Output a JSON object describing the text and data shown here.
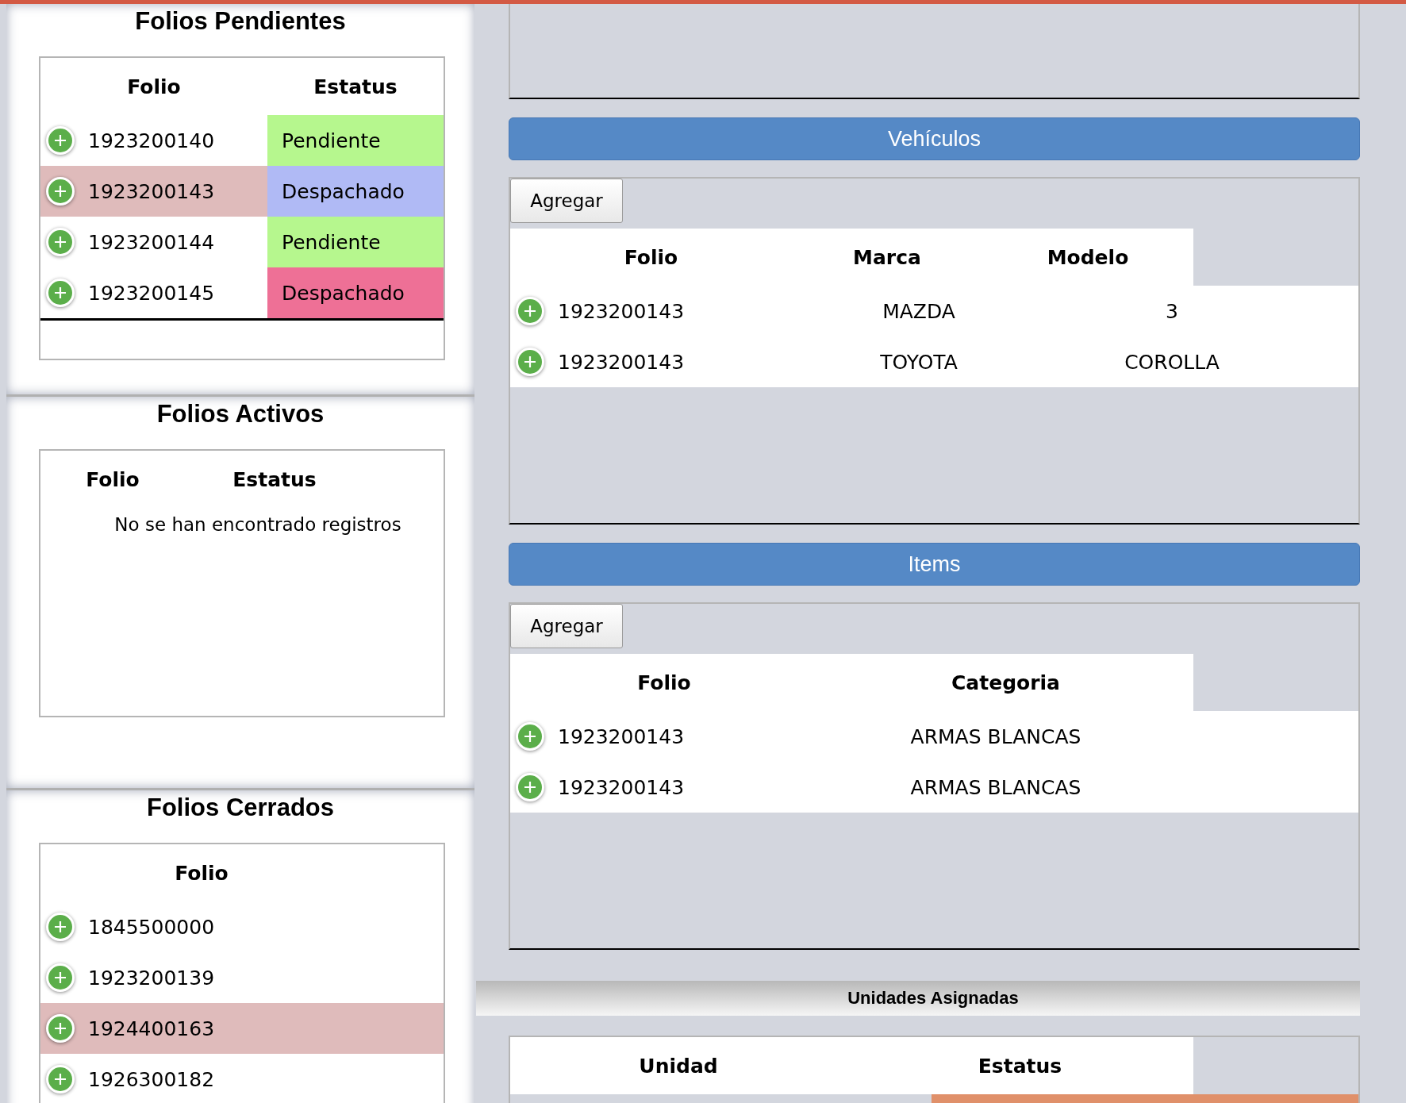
{
  "pending": {
    "title": "Folios Pendientes",
    "columns": [
      "Folio",
      "Estatus"
    ],
    "rows": [
      {
        "folio": "1923200140",
        "status": "Pendiente",
        "color": "#b6f78e",
        "selected": false
      },
      {
        "folio": "1923200143",
        "status": "Despachado",
        "color": "#b0baf5",
        "selected": true
      },
      {
        "folio": "1923200144",
        "status": "Pendiente",
        "color": "#b6f78e",
        "selected": false
      },
      {
        "folio": "1923200145",
        "status": "Despachado",
        "color": "#ee7096",
        "selected": false
      }
    ]
  },
  "active": {
    "title": "Folios Activos",
    "columns": [
      "Folio",
      "Estatus"
    ],
    "empty_message": "No se han encontrado registros"
  },
  "closed": {
    "title": "Folios Cerrados",
    "columns": [
      "Folio"
    ],
    "rows": [
      {
        "folio": "1845500000",
        "selected": false
      },
      {
        "folio": "1923200139",
        "selected": false
      },
      {
        "folio": "1924400163",
        "selected": true
      },
      {
        "folio": "1926300182",
        "selected": false
      }
    ]
  },
  "vehicles": {
    "title": "Vehículos",
    "add_button": "Agregar",
    "columns": [
      "Folio",
      "Marca",
      "Modelo"
    ],
    "rows": [
      {
        "cells": [
          "1923200143",
          "MAZDA",
          "3"
        ]
      },
      {
        "cells": [
          "1923200143",
          "TOYOTA",
          "COROLLA"
        ]
      }
    ]
  },
  "items": {
    "title": "Items",
    "add_button": "Agregar",
    "columns": [
      "Folio",
      "Categoria"
    ],
    "rows": [
      {
        "cells": [
          "1923200143",
          "ARMAS BLANCAS"
        ]
      },
      {
        "cells": [
          "1923200143",
          "ARMAS BLANCAS"
        ]
      }
    ]
  },
  "assigned_units": {
    "title": "Unidades Asignadas",
    "columns": [
      "Unidad",
      "Estatus"
    ],
    "rows": [
      {
        "color": "#e0906a"
      }
    ]
  }
}
